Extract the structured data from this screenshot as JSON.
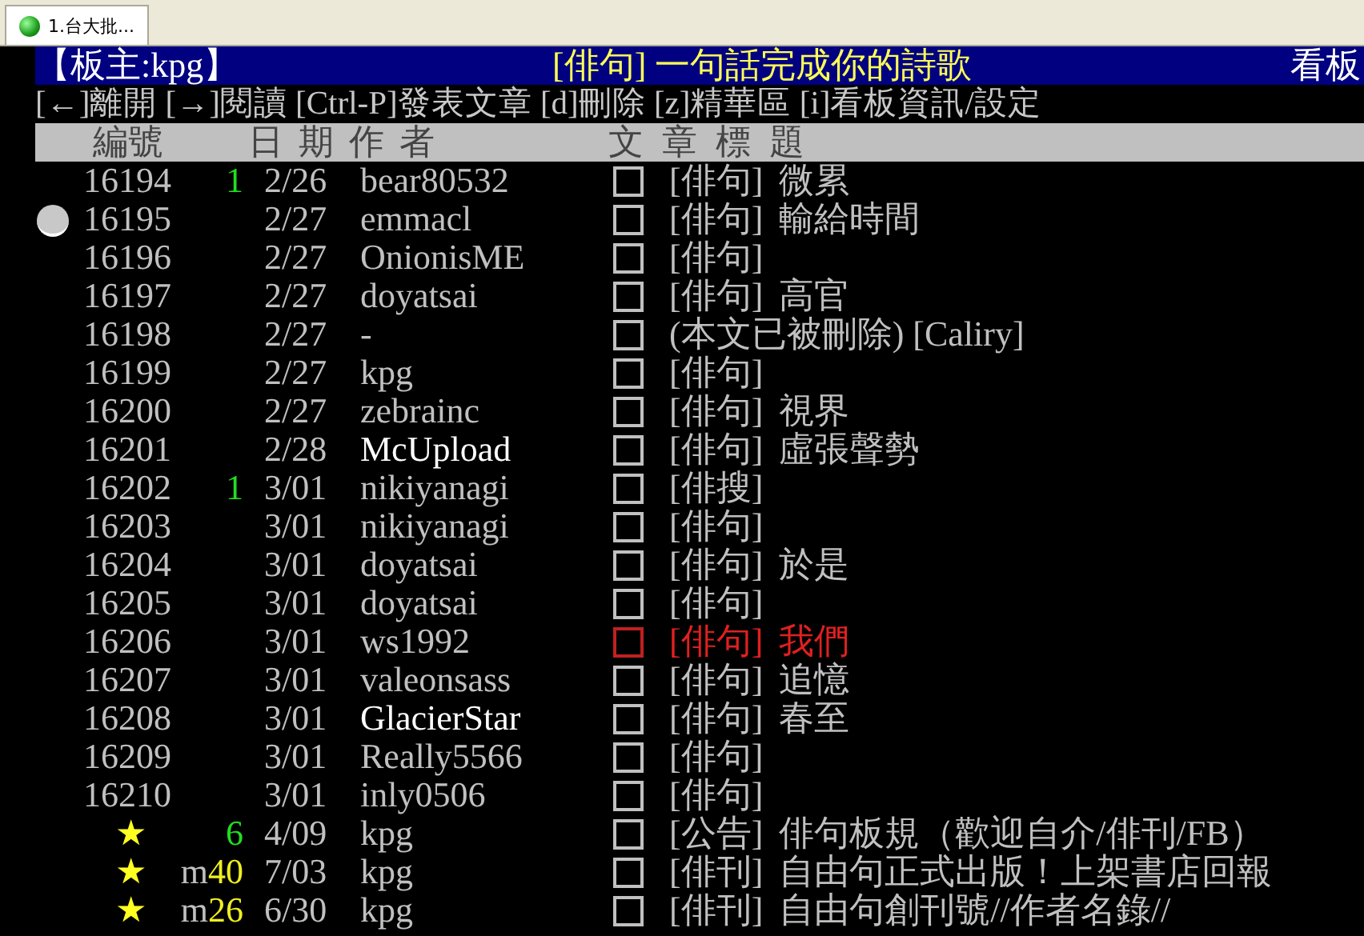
{
  "tab": {
    "label": "1.台大批...",
    "selected": true
  },
  "title_bar": {
    "moderator": "【板主:kpg】",
    "board": "[俳句] 一句話完成你的詩歌",
    "right": "看板"
  },
  "help_line": "[←]離開 [→]閱讀 [Ctrl-P]發表文章 [d]刪除 [z]精華區 [i]看板資訊/設定",
  "header": {
    "number": "編號",
    "date_author": "日 期 作  者",
    "title": "文  章  標  題"
  },
  "rows": [
    {
      "kind": "post",
      "number": "16194",
      "push": "1",
      "color": "#22dd22",
      "date": "2/26",
      "author": "bear80532",
      "bright": false,
      "flagged": false,
      "selected": false,
      "category": "[俳句]",
      "subject": "微累"
    },
    {
      "kind": "post",
      "number": "16195",
      "push": "",
      "date": "2/27",
      "author": "emmacl",
      "bright": false,
      "flagged": false,
      "selected": true,
      "category": "[俳句]",
      "subject": "輸給時間"
    },
    {
      "kind": "post",
      "number": "16196",
      "push": "",
      "date": "2/27",
      "author": "OnionisME",
      "bright": false,
      "flagged": false,
      "selected": false,
      "category": "[俳句]",
      "subject": ""
    },
    {
      "kind": "post",
      "number": "16197",
      "push": "",
      "date": "2/27",
      "author": "doyatsai",
      "bright": false,
      "flagged": false,
      "selected": false,
      "category": "[俳句]",
      "subject": "高官"
    },
    {
      "kind": "post",
      "number": "16198",
      "push": "",
      "date": "2/27",
      "author": "-",
      "bright": false,
      "flagged": false,
      "selected": false,
      "category": "",
      "subject": "(本文已被刪除) [Caliry]"
    },
    {
      "kind": "post",
      "number": "16199",
      "push": "",
      "date": "2/27",
      "author": "kpg",
      "bright": false,
      "flagged": false,
      "selected": false,
      "category": "[俳句]",
      "subject": ""
    },
    {
      "kind": "post",
      "number": "16200",
      "push": "",
      "date": "2/27",
      "author": "zebrainc",
      "bright": false,
      "flagged": false,
      "selected": false,
      "category": "[俳句]",
      "subject": "視界"
    },
    {
      "kind": "post",
      "number": "16201",
      "push": "",
      "date": "2/28",
      "author": "McUpload",
      "bright": true,
      "flagged": false,
      "selected": false,
      "category": "[俳句]",
      "subject": "虛張聲勢"
    },
    {
      "kind": "post",
      "number": "16202",
      "push": "1",
      "color": "#22dd22",
      "date": "3/01",
      "author": "nikiyanagi",
      "bright": false,
      "flagged": false,
      "selected": false,
      "category": "[俳搜]",
      "subject": ""
    },
    {
      "kind": "post",
      "number": "16203",
      "push": "",
      "date": "3/01",
      "author": "nikiyanagi",
      "bright": false,
      "flagged": false,
      "selected": false,
      "category": "[俳句]",
      "subject": ""
    },
    {
      "kind": "post",
      "number": "16204",
      "push": "",
      "date": "3/01",
      "author": "doyatsai",
      "bright": false,
      "flagged": false,
      "selected": false,
      "category": "[俳句]",
      "subject": "於是"
    },
    {
      "kind": "post",
      "number": "16205",
      "push": "",
      "date": "3/01",
      "author": "doyatsai",
      "bright": false,
      "flagged": false,
      "selected": false,
      "category": "[俳句]",
      "subject": ""
    },
    {
      "kind": "post",
      "number": "16206",
      "push": "",
      "date": "3/01",
      "author": "ws1992",
      "bright": false,
      "flagged": true,
      "selected": false,
      "category": "[俳句]",
      "subject": "我們"
    },
    {
      "kind": "post",
      "number": "16207",
      "push": "",
      "date": "3/01",
      "author": "valeonsass",
      "bright": false,
      "flagged": false,
      "selected": false,
      "category": "[俳句]",
      "subject": "追憶"
    },
    {
      "kind": "post",
      "number": "16208",
      "push": "",
      "date": "3/01",
      "author": "GlacierStar",
      "bright": true,
      "flagged": false,
      "selected": false,
      "category": "[俳句]",
      "subject": "春至"
    },
    {
      "kind": "post",
      "number": "16209",
      "push": "",
      "date": "3/01",
      "author": "Really5566",
      "bright": false,
      "flagged": false,
      "selected": false,
      "category": "[俳句]",
      "subject": ""
    },
    {
      "kind": "post",
      "number": "16210",
      "push": "",
      "date": "3/01",
      "author": "inly0506",
      "bright": false,
      "flagged": false,
      "selected": false,
      "category": "[俳句]",
      "subject": ""
    },
    {
      "kind": "pinned",
      "number": "★",
      "push": "6",
      "color": "#22dd22",
      "date": "4/09",
      "author": "kpg",
      "bright": false,
      "flagged": false,
      "selected": false,
      "category": "[公告]",
      "subject": "俳句板規（歡迎自介/俳刊/FB）"
    },
    {
      "kind": "pinned",
      "number": "★",
      "push": "40",
      "push_prefix": "m",
      "color": "#eeee22",
      "date": "7/03",
      "author": "kpg",
      "bright": false,
      "flagged": false,
      "selected": false,
      "category": "[俳刊]",
      "subject": "自由句正式出版！上架書店回報"
    },
    {
      "kind": "pinned",
      "number": "★",
      "push": "26",
      "push_prefix": "m",
      "color": "#eeee22",
      "date": "6/30",
      "author": "kpg",
      "bright": false,
      "flagged": false,
      "selected": false,
      "category": "[俳刊]",
      "subject": "自由句創刊號//作者名錄//"
    }
  ]
}
